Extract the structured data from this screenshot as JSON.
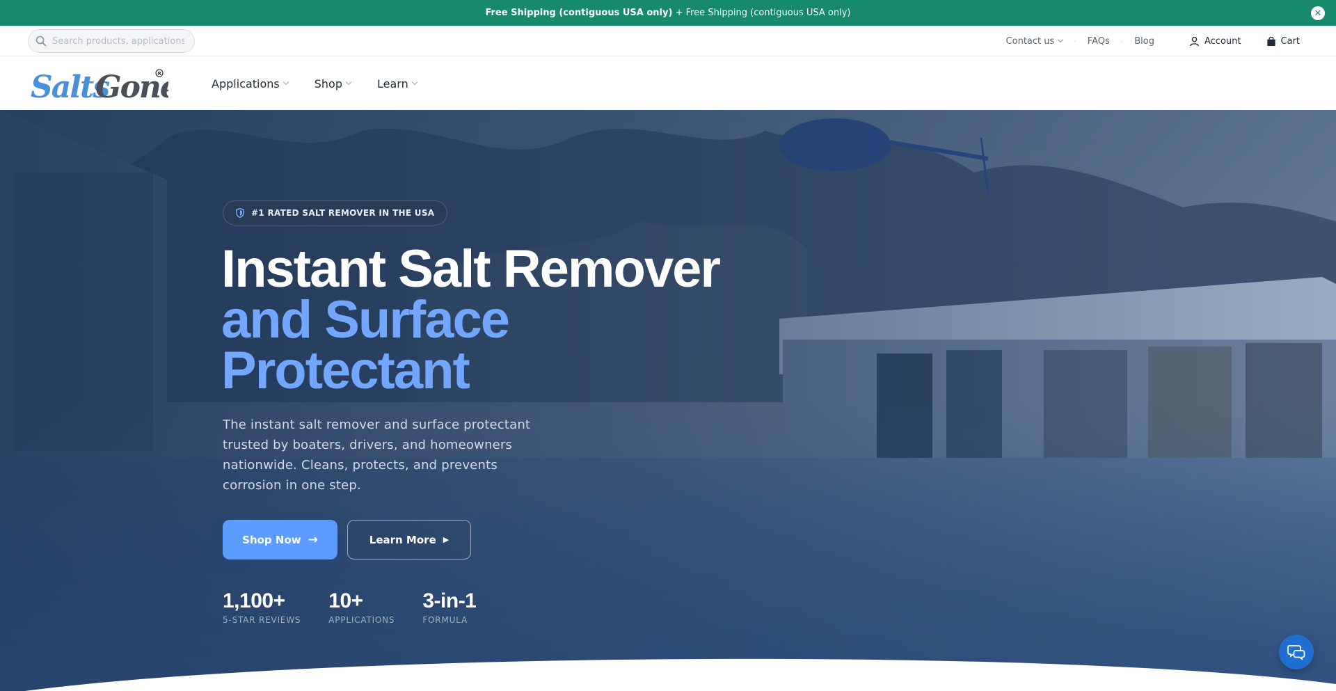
{
  "announcement": {
    "bold_text": "Free Shipping (contiguous USA only)",
    "rest_text": " + Free Shipping (contiguous USA only)",
    "close_label": "✕"
  },
  "utility": {
    "search_placeholder": "Search products, applications...",
    "contact": "Contact us",
    "faqs": "FAQs",
    "blog": "Blog",
    "account": "Account",
    "cart": "Cart"
  },
  "logo": {
    "text": "Salts Gone",
    "registered": "®"
  },
  "nav": {
    "items": [
      {
        "label": "Applications"
      },
      {
        "label": "Shop"
      },
      {
        "label": "Learn"
      }
    ]
  },
  "hero": {
    "badge": "#1 RATED SALT REMOVER IN THE USA",
    "title_line1": "Instant Salt Remover",
    "title_line2": "and Surface Protectant",
    "description": "The instant salt remover and surface protectant trusted by boaters, drivers, and homeowners nationwide. Cleans, protects, and prevents corrosion in one step.",
    "primary_button": "Shop Now",
    "secondary_button": "Learn More",
    "stats": [
      {
        "value": "1,100+",
        "label": "5-STAR REVIEWS"
      },
      {
        "value": "10+",
        "label": "APPLICATIONS"
      },
      {
        "value": "3-in-1",
        "label": "FORMULA"
      }
    ]
  },
  "colors": {
    "announcement_bg": "#168a6a",
    "accent_blue": "#5c9bff",
    "title_blue": "#72a6ff",
    "logo_blue": "#4a90d9",
    "logo_gray": "#4a4f57"
  },
  "icons": [
    "search-icon",
    "chevron-down-icon",
    "user-icon",
    "bag-icon",
    "shield-icon",
    "arrow-right-icon",
    "play-icon",
    "chat-icon",
    "close-icon"
  ]
}
